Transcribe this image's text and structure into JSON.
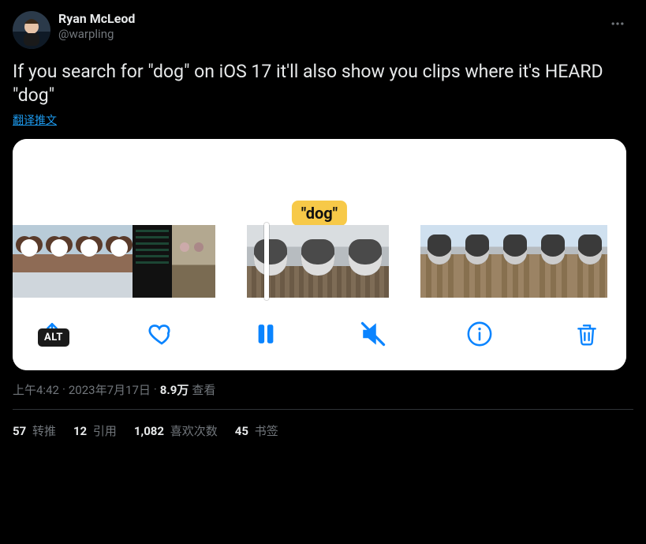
{
  "author": {
    "display_name": "Ryan McLeod",
    "handle": "@warpling"
  },
  "body_text": "If you search for \"dog\" on iOS 17 it'll also show you clips where it's HEARD \"dog\"",
  "translate_label": "翻译推文",
  "media": {
    "caption_tag": "\"dog\"",
    "alt_badge": "ALT"
  },
  "meta": {
    "time": "上午4:42",
    "dot1": " · ",
    "date": "2023年7月17日",
    "dot2": " · ",
    "views_count": "8.9万",
    "views_label": " 查看"
  },
  "stats": {
    "retweets": {
      "count": "57",
      "label": " 转推"
    },
    "quotes": {
      "count": "12",
      "label": " 引用"
    },
    "likes": {
      "count": "1,082",
      "label": " 喜欢次数"
    },
    "bookmarks": {
      "count": "45",
      "label": " 书签"
    }
  }
}
